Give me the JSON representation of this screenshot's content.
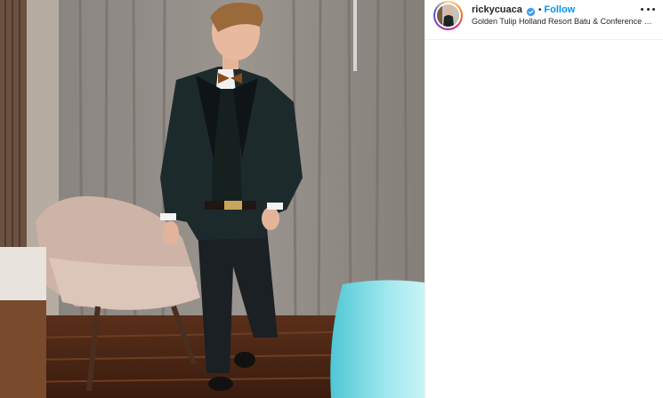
{
  "post": {
    "image_alt": "Man in a black tuxedo with a bow tie standing in a hotel room"
  },
  "header": {
    "username": "rickycuaca",
    "separator": "•",
    "follow_label": "Follow",
    "location": "Golden Tulip Holland Resort Batu & Conference Center",
    "more_icon": "more-horizontal-icon",
    "verified_icon": "verified-badge-icon"
  },
  "colors": {
    "follow": "#0095f6",
    "verified": "#3897f0",
    "text": "#262626",
    "divider": "#efefef"
  }
}
